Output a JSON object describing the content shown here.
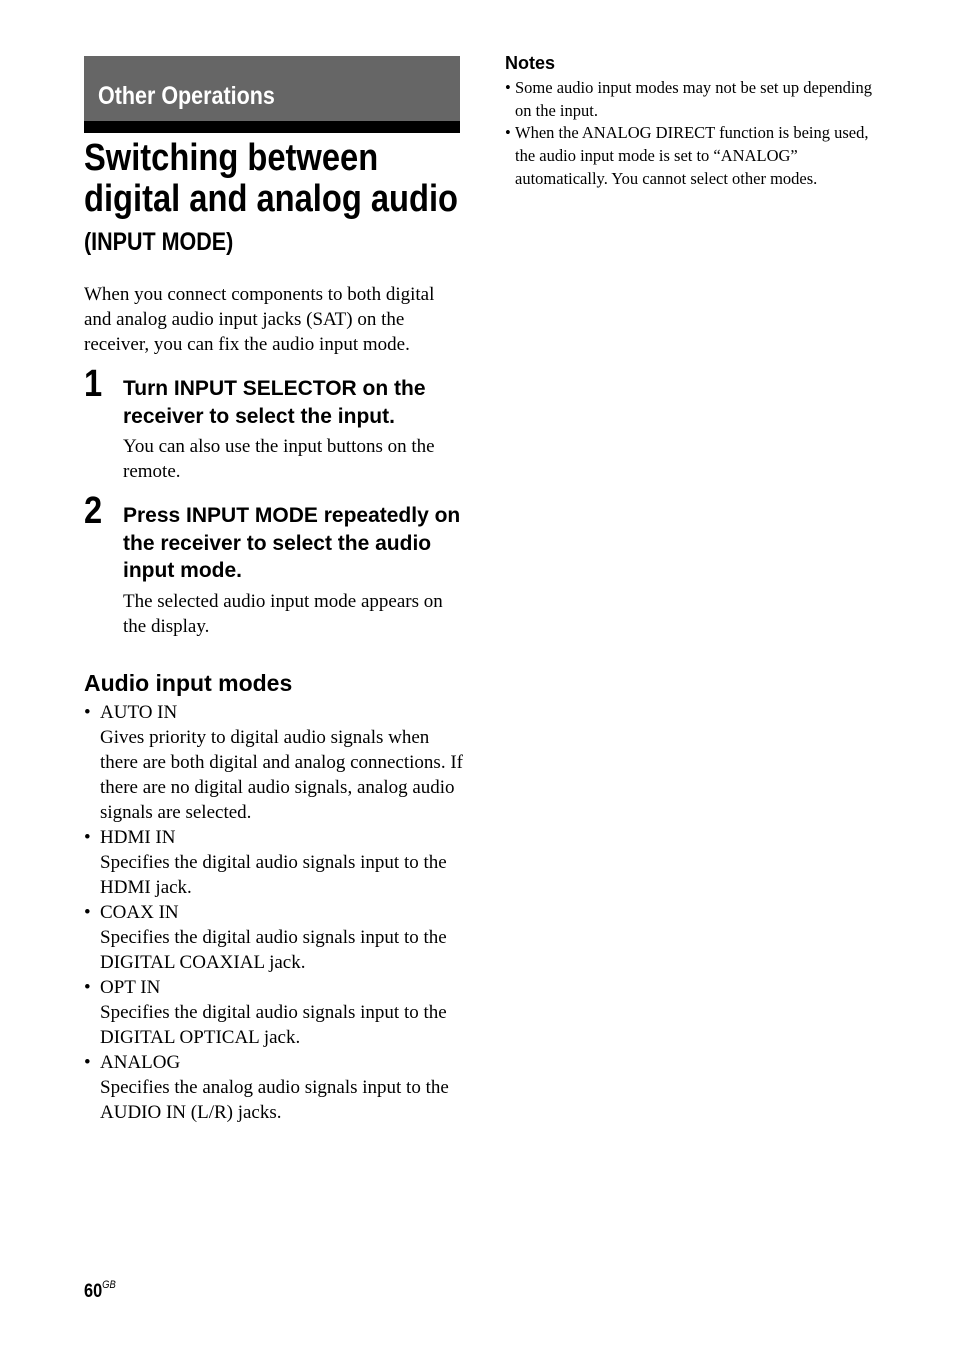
{
  "section": {
    "title": "Other Operations"
  },
  "header": {
    "title_lines": [
      "Switching between",
      "digital and analog audio"
    ],
    "subtitle": "(INPUT MODE)"
  },
  "intro": "When you connect components to both digital and analog audio input jacks (SAT) on the receiver, you can fix the audio input mode.",
  "steps": [
    {
      "number": "1",
      "heading": "Turn INPUT SELECTOR on the receiver to select the input.",
      "body": "You can also use the input buttons on the remote."
    },
    {
      "number": "2",
      "heading": "Press INPUT MODE repeatedly on the receiver to select the audio input mode.",
      "body": "The selected audio input mode appears on the display."
    }
  ],
  "audio_modes": {
    "heading": "Audio input modes",
    "bullet": "•",
    "items": [
      {
        "name": "AUTO IN",
        "description": "Gives priority to digital audio signals when there are both digital and analog connections. If there are no digital audio signals, analog audio signals are selected."
      },
      {
        "name": "HDMI IN",
        "description": "Specifies the digital audio signals input to the HDMI jack."
      },
      {
        "name": "COAX IN",
        "description": "Specifies the digital audio signals input to the DIGITAL COAXIAL jack."
      },
      {
        "name": "OPT IN",
        "description": "Specifies the digital audio signals input to the DIGITAL OPTICAL jack."
      },
      {
        "name": "ANALOG",
        "description": "Specifies the analog audio signals input to the AUDIO IN (L/R) jacks."
      }
    ]
  },
  "notes": {
    "heading": "Notes",
    "bullet": "•",
    "items": [
      "Some audio input modes may not be set up depending on the input.",
      "When the ANALOG DIRECT function is being used, the audio input mode is set to “ANALOG” automatically. You cannot select other modes."
    ]
  },
  "footer": {
    "page_number": "60",
    "page_suffix": "GB"
  }
}
